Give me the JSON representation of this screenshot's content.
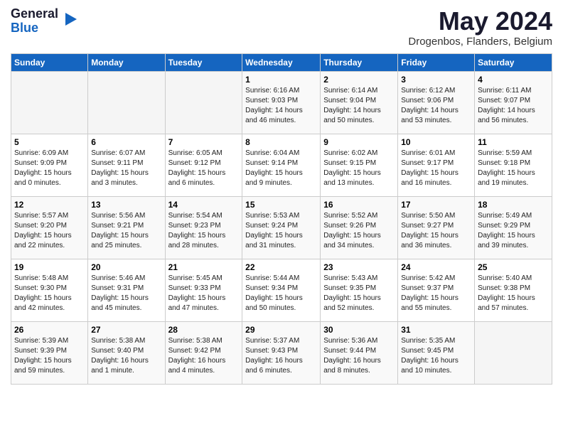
{
  "logo": {
    "general": "General",
    "blue": "Blue"
  },
  "header": {
    "month": "May 2024",
    "location": "Drogenbos, Flanders, Belgium"
  },
  "weekdays": [
    "Sunday",
    "Monday",
    "Tuesday",
    "Wednesday",
    "Thursday",
    "Friday",
    "Saturday"
  ],
  "weeks": [
    [
      {
        "day": "",
        "info": ""
      },
      {
        "day": "",
        "info": ""
      },
      {
        "day": "",
        "info": ""
      },
      {
        "day": "1",
        "info": "Sunrise: 6:16 AM\nSunset: 9:03 PM\nDaylight: 14 hours\nand 46 minutes."
      },
      {
        "day": "2",
        "info": "Sunrise: 6:14 AM\nSunset: 9:04 PM\nDaylight: 14 hours\nand 50 minutes."
      },
      {
        "day": "3",
        "info": "Sunrise: 6:12 AM\nSunset: 9:06 PM\nDaylight: 14 hours\nand 53 minutes."
      },
      {
        "day": "4",
        "info": "Sunrise: 6:11 AM\nSunset: 9:07 PM\nDaylight: 14 hours\nand 56 minutes."
      }
    ],
    [
      {
        "day": "5",
        "info": "Sunrise: 6:09 AM\nSunset: 9:09 PM\nDaylight: 15 hours\nand 0 minutes."
      },
      {
        "day": "6",
        "info": "Sunrise: 6:07 AM\nSunset: 9:11 PM\nDaylight: 15 hours\nand 3 minutes."
      },
      {
        "day": "7",
        "info": "Sunrise: 6:05 AM\nSunset: 9:12 PM\nDaylight: 15 hours\nand 6 minutes."
      },
      {
        "day": "8",
        "info": "Sunrise: 6:04 AM\nSunset: 9:14 PM\nDaylight: 15 hours\nand 9 minutes."
      },
      {
        "day": "9",
        "info": "Sunrise: 6:02 AM\nSunset: 9:15 PM\nDaylight: 15 hours\nand 13 minutes."
      },
      {
        "day": "10",
        "info": "Sunrise: 6:01 AM\nSunset: 9:17 PM\nDaylight: 15 hours\nand 16 minutes."
      },
      {
        "day": "11",
        "info": "Sunrise: 5:59 AM\nSunset: 9:18 PM\nDaylight: 15 hours\nand 19 minutes."
      }
    ],
    [
      {
        "day": "12",
        "info": "Sunrise: 5:57 AM\nSunset: 9:20 PM\nDaylight: 15 hours\nand 22 minutes."
      },
      {
        "day": "13",
        "info": "Sunrise: 5:56 AM\nSunset: 9:21 PM\nDaylight: 15 hours\nand 25 minutes."
      },
      {
        "day": "14",
        "info": "Sunrise: 5:54 AM\nSunset: 9:23 PM\nDaylight: 15 hours\nand 28 minutes."
      },
      {
        "day": "15",
        "info": "Sunrise: 5:53 AM\nSunset: 9:24 PM\nDaylight: 15 hours\nand 31 minutes."
      },
      {
        "day": "16",
        "info": "Sunrise: 5:52 AM\nSunset: 9:26 PM\nDaylight: 15 hours\nand 34 minutes."
      },
      {
        "day": "17",
        "info": "Sunrise: 5:50 AM\nSunset: 9:27 PM\nDaylight: 15 hours\nand 36 minutes."
      },
      {
        "day": "18",
        "info": "Sunrise: 5:49 AM\nSunset: 9:29 PM\nDaylight: 15 hours\nand 39 minutes."
      }
    ],
    [
      {
        "day": "19",
        "info": "Sunrise: 5:48 AM\nSunset: 9:30 PM\nDaylight: 15 hours\nand 42 minutes."
      },
      {
        "day": "20",
        "info": "Sunrise: 5:46 AM\nSunset: 9:31 PM\nDaylight: 15 hours\nand 45 minutes."
      },
      {
        "day": "21",
        "info": "Sunrise: 5:45 AM\nSunset: 9:33 PM\nDaylight: 15 hours\nand 47 minutes."
      },
      {
        "day": "22",
        "info": "Sunrise: 5:44 AM\nSunset: 9:34 PM\nDaylight: 15 hours\nand 50 minutes."
      },
      {
        "day": "23",
        "info": "Sunrise: 5:43 AM\nSunset: 9:35 PM\nDaylight: 15 hours\nand 52 minutes."
      },
      {
        "day": "24",
        "info": "Sunrise: 5:42 AM\nSunset: 9:37 PM\nDaylight: 15 hours\nand 55 minutes."
      },
      {
        "day": "25",
        "info": "Sunrise: 5:40 AM\nSunset: 9:38 PM\nDaylight: 15 hours\nand 57 minutes."
      }
    ],
    [
      {
        "day": "26",
        "info": "Sunrise: 5:39 AM\nSunset: 9:39 PM\nDaylight: 15 hours\nand 59 minutes."
      },
      {
        "day": "27",
        "info": "Sunrise: 5:38 AM\nSunset: 9:40 PM\nDaylight: 16 hours\nand 1 minute."
      },
      {
        "day": "28",
        "info": "Sunrise: 5:38 AM\nSunset: 9:42 PM\nDaylight: 16 hours\nand 4 minutes."
      },
      {
        "day": "29",
        "info": "Sunrise: 5:37 AM\nSunset: 9:43 PM\nDaylight: 16 hours\nand 6 minutes."
      },
      {
        "day": "30",
        "info": "Sunrise: 5:36 AM\nSunset: 9:44 PM\nDaylight: 16 hours\nand 8 minutes."
      },
      {
        "day": "31",
        "info": "Sunrise: 5:35 AM\nSunset: 9:45 PM\nDaylight: 16 hours\nand 10 minutes."
      },
      {
        "day": "",
        "info": ""
      }
    ]
  ]
}
